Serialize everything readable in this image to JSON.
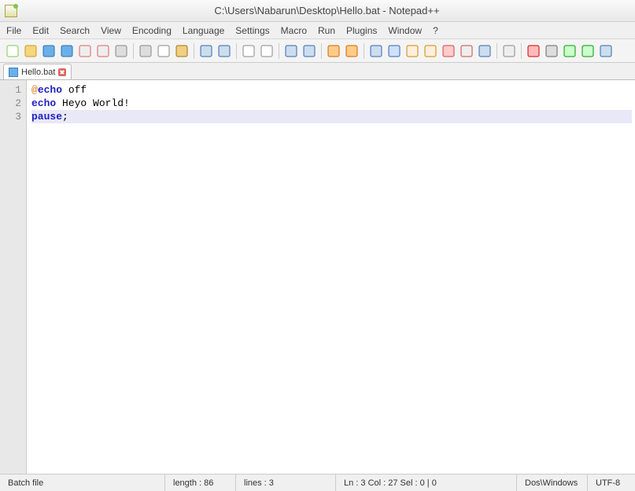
{
  "window": {
    "title": "C:\\Users\\Nabarun\\Desktop\\Hello.bat - Notepad++"
  },
  "menu": [
    "File",
    "Edit",
    "Search",
    "View",
    "Encoding",
    "Language",
    "Settings",
    "Macro",
    "Run",
    "Plugins",
    "Window",
    "?"
  ],
  "toolbar_icons": [
    "new-file",
    "open-file",
    "save",
    "save-all",
    "close",
    "close-all",
    "print",
    "sep",
    "cut",
    "copy",
    "paste",
    "sep",
    "undo",
    "redo",
    "sep",
    "find",
    "replace",
    "sep",
    "zoom-in",
    "zoom-out",
    "sep",
    "sync-v",
    "sync-h",
    "sep",
    "word-wrap",
    "show-all",
    "indent-guide",
    "folder",
    "user-lang",
    "doc-map",
    "func-list",
    "sep",
    "monitor",
    "sep",
    "record",
    "stop",
    "play",
    "play-multi",
    "save-macro"
  ],
  "tab": {
    "filename": "Hello.bat"
  },
  "code": {
    "lines": [
      {
        "n": 1,
        "tokens": [
          [
            "at",
            "@"
          ],
          [
            "kw",
            "echo"
          ],
          [
            "",
            " off"
          ]
        ]
      },
      {
        "n": 2,
        "tokens": [
          [
            "kw",
            "echo"
          ],
          [
            "",
            " Heyo World!"
          ]
        ]
      },
      {
        "n": 3,
        "tokens": [
          [
            "kw",
            "pause"
          ],
          [
            "",
            ";"
          ]
        ],
        "current": true
      }
    ]
  },
  "status": {
    "lang": "Batch file",
    "length_label": "length : 86",
    "lines_label": "lines : 3",
    "pos_label": "Ln : 3    Col : 27    Sel : 0 | 0",
    "eol": "Dos\\Windows",
    "encoding": "UTF-8"
  }
}
